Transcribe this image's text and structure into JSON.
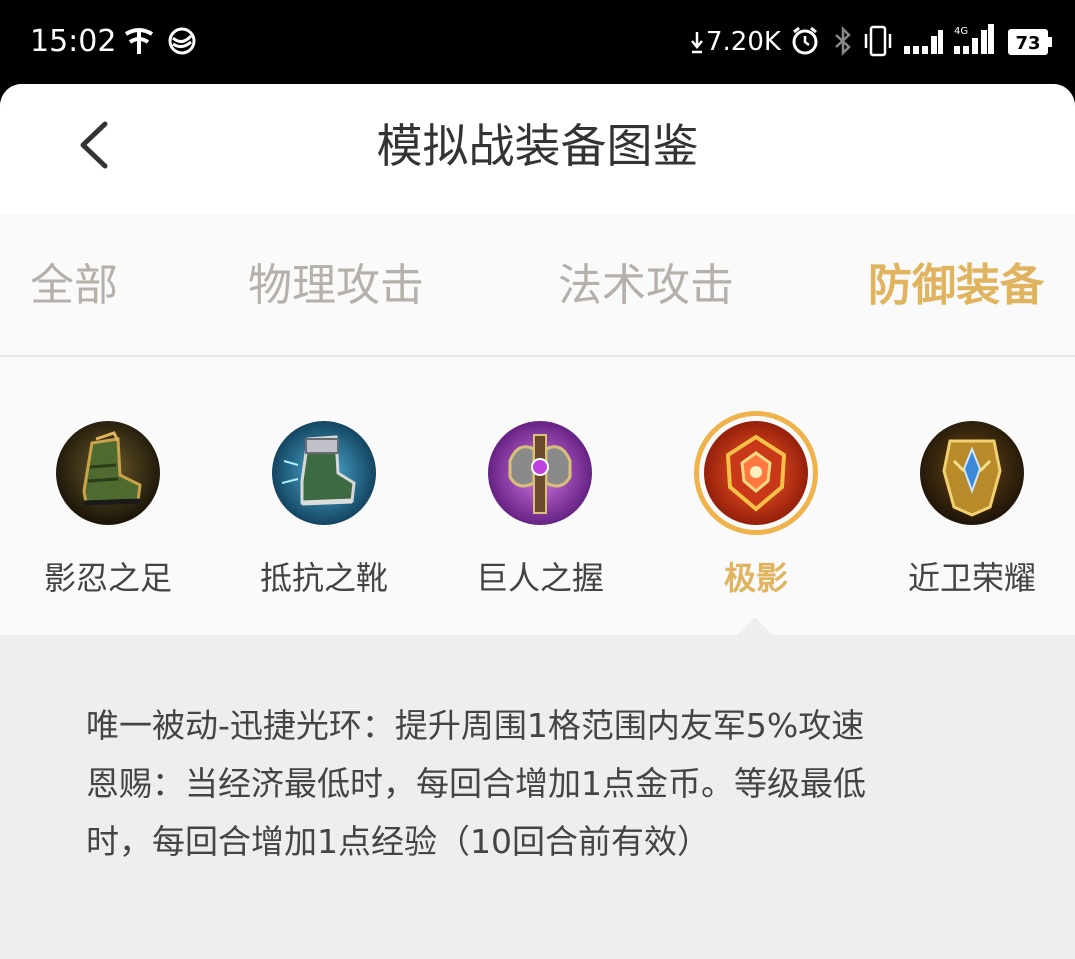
{
  "status_bar": {
    "time": "15:02",
    "net_speed": "7.20K",
    "battery": "73",
    "icons": [
      "china-telecom-icon",
      "china-mobile-icon",
      "download-arrow-icon",
      "alarm-icon",
      "bluetooth-icon",
      "vibrate-icon",
      "signal-icon",
      "signal-4g-icon",
      "battery-icon"
    ]
  },
  "header": {
    "title": "模拟战装备图鉴",
    "back_icon": "chevron-left-icon"
  },
  "tabs": [
    {
      "label": "全部",
      "active": false
    },
    {
      "label": "物理攻击",
      "active": false
    },
    {
      "label": "法术攻击",
      "active": false
    },
    {
      "label": "防御装备",
      "active": true
    }
  ],
  "items": [
    {
      "name": "影忍之足",
      "icon": "boot-icon",
      "active": false
    },
    {
      "name": "抵抗之靴",
      "icon": "armored-boot-icon",
      "active": false
    },
    {
      "name": "巨人之握",
      "icon": "axe-icon",
      "active": false
    },
    {
      "name": "极影",
      "icon": "crest-icon",
      "active": true
    },
    {
      "name": "近卫荣耀",
      "icon": "gold-shield-icon",
      "active": false
    }
  ],
  "description": {
    "line1": "唯一被动-迅捷光环：提升周围1格范围内友军5%攻速",
    "line2": "恩赐：当经济最低时，每回合增加1点金币。等级最低",
    "line3": "时，每回合增加1点经验（10回合前有效）"
  },
  "colors": {
    "accent": "#e0b45f",
    "ring": "#f0b24a",
    "tab_inactive": "#b5b0aa",
    "panel": "#eeeeee"
  }
}
